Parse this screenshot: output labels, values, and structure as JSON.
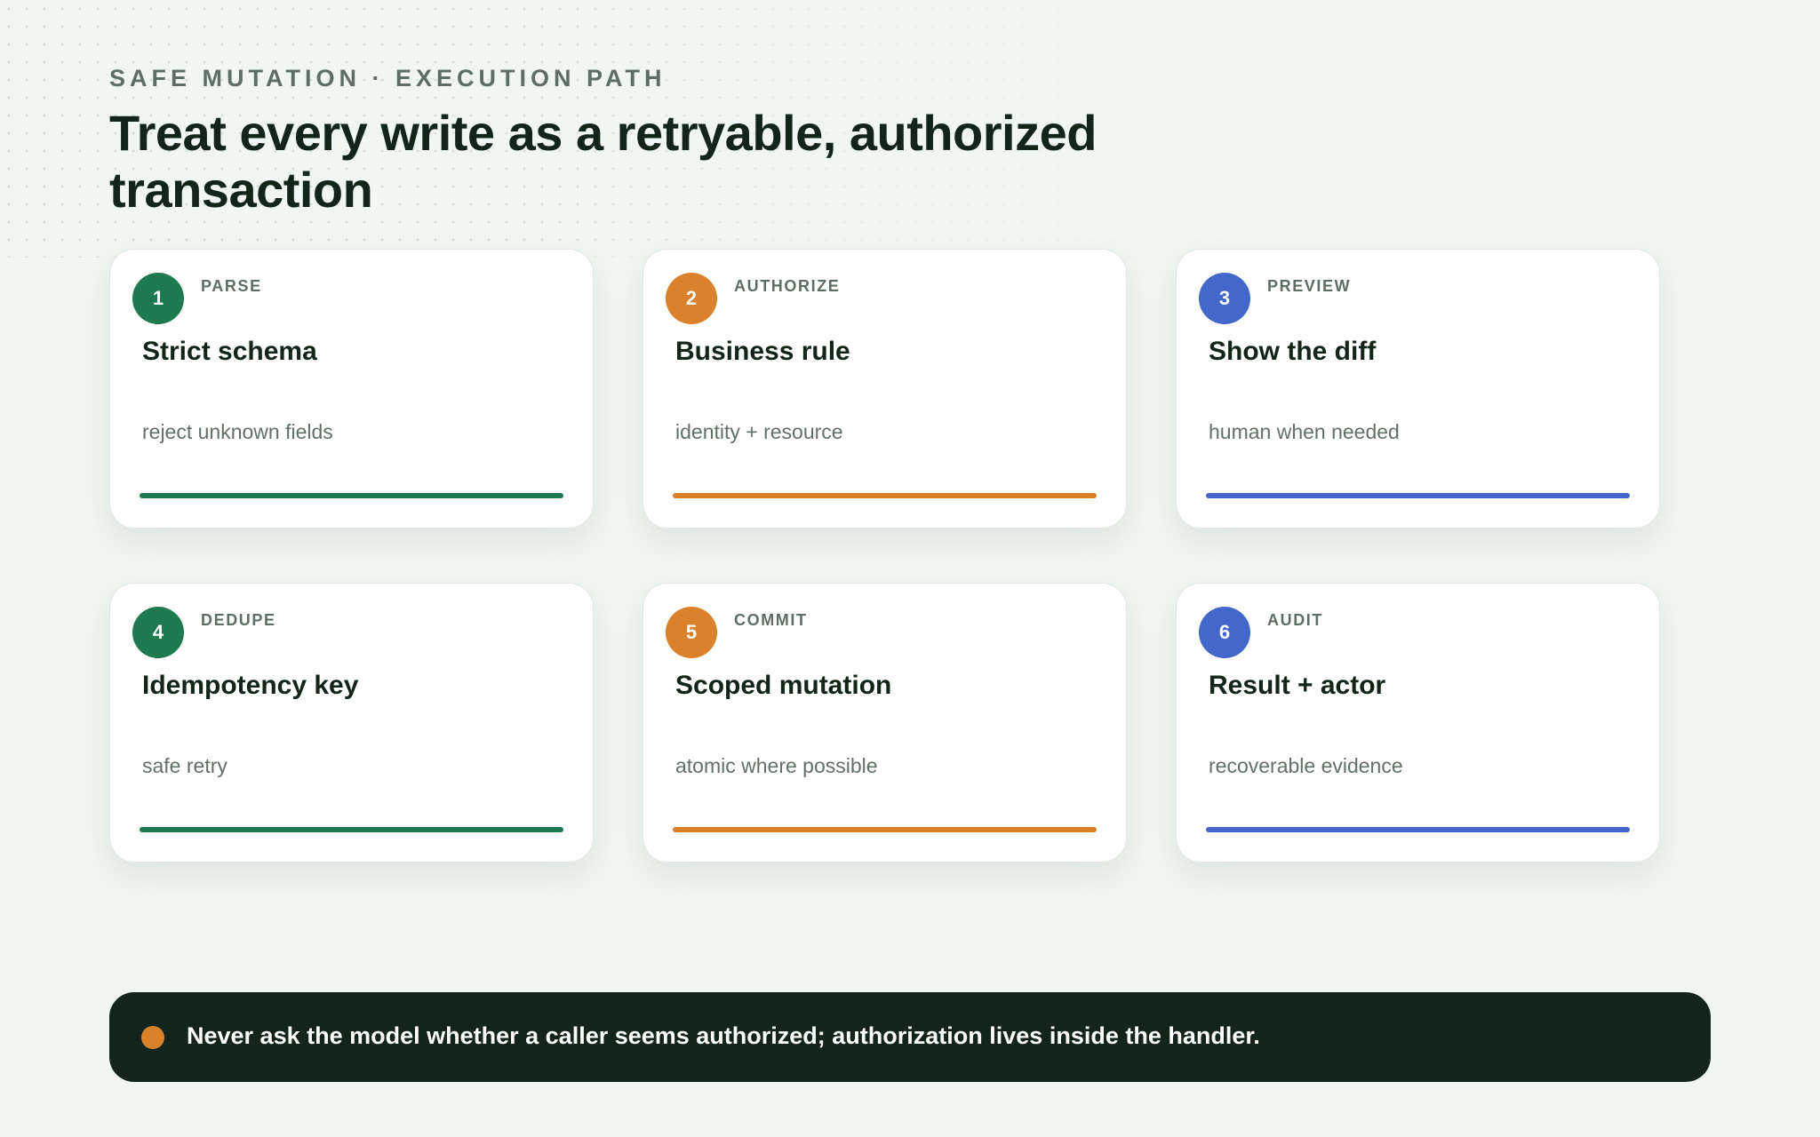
{
  "header": {
    "eyebrow": "SAFE MUTATION · EXECUTION PATH",
    "title": "Treat every write as a retryable, authorized transaction"
  },
  "colors": {
    "green": "#1e7a4e",
    "orange": "#d9812b",
    "blue": "#4266c9",
    "background": "#f1f6f2",
    "callout_bg": "#13241b"
  },
  "steps": [
    {
      "number": "1",
      "kicker": "PARSE",
      "title": "Strict schema",
      "desc": "reject unknown fields",
      "color": "#1e7a4e"
    },
    {
      "number": "2",
      "kicker": "AUTHORIZE",
      "title": "Business rule",
      "desc": "identity + resource",
      "color": "#d9812b"
    },
    {
      "number": "3",
      "kicker": "PREVIEW",
      "title": "Show the diff",
      "desc": "human when needed",
      "color": "#4266c9"
    },
    {
      "number": "4",
      "kicker": "DEDUPE",
      "title": "Idempotency key",
      "desc": "safe retry",
      "color": "#1e7a4e"
    },
    {
      "number": "5",
      "kicker": "COMMIT",
      "title": "Scoped mutation",
      "desc": "atomic where possible",
      "color": "#d9812b"
    },
    {
      "number": "6",
      "kicker": "AUDIT",
      "title": "Result + actor",
      "desc": "recoverable evidence",
      "color": "#4266c9"
    }
  ],
  "callout": {
    "text": "Never ask the model whether a caller seems authorized; authorization lives inside the handler.",
    "dot_color": "#d9812b"
  }
}
